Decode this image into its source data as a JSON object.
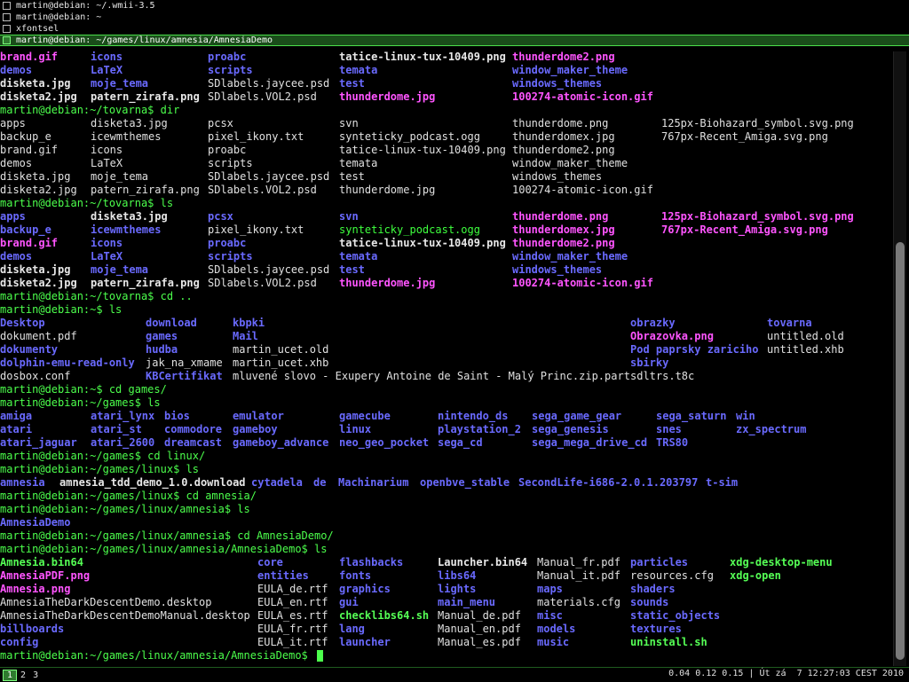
{
  "colors": {
    "prompt": "#4cff4c",
    "directory": "#6a6aff",
    "executable": "#55ff55",
    "image": "#ff55ff",
    "text": "#e0e0e0",
    "border_active": "#4be04b"
  },
  "windows": [
    {
      "title": "martin@debian: ~/.wmii-3.5"
    },
    {
      "title": "martin@debian: ~"
    },
    {
      "title": "xfontsel"
    },
    {
      "title": "martin@debian: ~/games/linux/amnesia/AmnesiaDemo",
      "active": true
    }
  ],
  "terminal": {
    "lines": [
      [
        [
          0,
          "brand.gif",
          "i"
        ],
        [
          102,
          "icons",
          "d"
        ],
        [
          234,
          "proabc",
          "d"
        ],
        [
          382,
          "tatice-linux-tux-10409.png",
          "w"
        ],
        [
          577,
          "thunderdome2.png",
          "i"
        ]
      ],
      [
        [
          0,
          "demos",
          "d"
        ],
        [
          102,
          "LaTeX",
          "d"
        ],
        [
          234,
          "scripts",
          "d"
        ],
        [
          382,
          "temata",
          "d"
        ],
        [
          577,
          "window_maker_theme",
          "d"
        ]
      ],
      [
        [
          0,
          "disketa.jpg",
          "w"
        ],
        [
          102,
          "moje_tema",
          "d"
        ],
        [
          234,
          "SDlabels.jaycee.psd",
          ""
        ],
        [
          382,
          "test",
          "d"
        ],
        [
          577,
          "windows_themes",
          "d"
        ]
      ],
      [
        [
          0,
          "disketa2.jpg",
          "w"
        ],
        [
          102,
          "patern_zirafa.png",
          "w"
        ],
        [
          234,
          "SDlabels.VOL2.psd",
          ""
        ],
        [
          382,
          "thunderdome.jpg",
          "i"
        ],
        [
          577,
          "100274-atomic-icon.gif",
          "i"
        ]
      ],
      [
        [
          0,
          "martin@debian:~/tovarna$ dir",
          "p"
        ]
      ],
      [
        [
          0,
          "apps",
          ""
        ],
        [
          102,
          "disketa3.jpg",
          ""
        ],
        [
          234,
          "pcsx",
          ""
        ],
        [
          382,
          "svn",
          ""
        ],
        [
          577,
          "thunderdome.png",
          ""
        ],
        [
          745,
          "125px-Biohazard_symbol.svg.png",
          ""
        ]
      ],
      [
        [
          0,
          "backup_e",
          ""
        ],
        [
          102,
          "icewmthemes",
          ""
        ],
        [
          234,
          "pixel_ikony.txt",
          ""
        ],
        [
          382,
          "synteticky_podcast.ogg",
          ""
        ],
        [
          577,
          "thunderdomex.jpg",
          ""
        ],
        [
          745,
          "767px-Recent_Amiga.svg.png",
          ""
        ]
      ],
      [
        [
          0,
          "brand.gif",
          ""
        ],
        [
          102,
          "icons",
          ""
        ],
        [
          234,
          "proabc",
          ""
        ],
        [
          382,
          "tatice-linux-tux-10409.png",
          ""
        ],
        [
          577,
          "thunderdome2.png",
          ""
        ]
      ],
      [
        [
          0,
          "demos",
          ""
        ],
        [
          102,
          "LaTeX",
          ""
        ],
        [
          234,
          "scripts",
          ""
        ],
        [
          382,
          "temata",
          ""
        ],
        [
          577,
          "window_maker_theme",
          ""
        ]
      ],
      [
        [
          0,
          "disketa.jpg",
          ""
        ],
        [
          102,
          "moje_tema",
          ""
        ],
        [
          234,
          "SDlabels.jaycee.psd",
          ""
        ],
        [
          382,
          "test",
          ""
        ],
        [
          577,
          "windows_themes",
          ""
        ]
      ],
      [
        [
          0,
          "disketa2.jpg",
          ""
        ],
        [
          102,
          "patern_zirafa.png",
          ""
        ],
        [
          234,
          "SDlabels.VOL2.psd",
          ""
        ],
        [
          382,
          "thunderdome.jpg",
          ""
        ],
        [
          577,
          "100274-atomic-icon.gif",
          ""
        ]
      ],
      [
        [
          0,
          "martin@debian:~/tovarna$ ls",
          "p"
        ]
      ],
      [
        [
          0,
          "apps",
          "d"
        ],
        [
          102,
          "disketa3.jpg",
          "w"
        ],
        [
          234,
          "pcsx",
          "d"
        ],
        [
          382,
          "svn",
          "d"
        ],
        [
          577,
          "thunderdome.png",
          "i"
        ],
        [
          745,
          "125px-Biohazard_symbol.svg.png",
          "i"
        ]
      ],
      [
        [
          0,
          "backup_e",
          "d"
        ],
        [
          102,
          "icewmthemes",
          "d"
        ],
        [
          234,
          "pixel_ikony.txt",
          ""
        ],
        [
          382,
          "synteticky_podcast.ogg",
          "t"
        ],
        [
          577,
          "thunderdomex.jpg",
          "i"
        ],
        [
          745,
          "767px-Recent_Amiga.svg.png",
          "i"
        ]
      ],
      [
        [
          0,
          "brand.gif",
          "i"
        ],
        [
          102,
          "icons",
          "d"
        ],
        [
          234,
          "proabc",
          "d"
        ],
        [
          382,
          "tatice-linux-tux-10409.png",
          "w"
        ],
        [
          577,
          "thunderdome2.png",
          "i"
        ]
      ],
      [
        [
          0,
          "demos",
          "d"
        ],
        [
          102,
          "LaTeX",
          "d"
        ],
        [
          234,
          "scripts",
          "d"
        ],
        [
          382,
          "temata",
          "d"
        ],
        [
          577,
          "window_maker_theme",
          "d"
        ]
      ],
      [
        [
          0,
          "disketa.jpg",
          "w"
        ],
        [
          102,
          "moje_tema",
          "d"
        ],
        [
          234,
          "SDlabels.jaycee.psd",
          ""
        ],
        [
          382,
          "test",
          "d"
        ],
        [
          577,
          "windows_themes",
          "d"
        ]
      ],
      [
        [
          0,
          "disketa2.jpg",
          "w"
        ],
        [
          102,
          "patern_zirafa.png",
          "w"
        ],
        [
          234,
          "SDlabels.VOL2.psd",
          ""
        ],
        [
          382,
          "thunderdome.jpg",
          "i"
        ],
        [
          577,
          "100274-atomic-icon.gif",
          "i"
        ]
      ],
      [
        [
          0,
          "martin@debian:~/tovarna$ cd ..",
          "p"
        ]
      ],
      [
        [
          0,
          "martin@debian:~$ ls",
          "p"
        ]
      ],
      [
        [
          0,
          "Desktop",
          "d"
        ],
        [
          164,
          "download",
          "d"
        ],
        [
          262,
          "kbpki",
          "d"
        ],
        [
          710,
          "obrazky",
          "d"
        ],
        [
          864,
          "tovarna",
          "d"
        ]
      ],
      [
        [
          0,
          "dokument.pdf",
          ""
        ],
        [
          164,
          "games",
          "d"
        ],
        [
          262,
          "Mail",
          "d"
        ],
        [
          710,
          "Obrazovka.png",
          "i"
        ],
        [
          864,
          "untitled.old",
          ""
        ]
      ],
      [
        [
          0,
          "dokumenty",
          "d"
        ],
        [
          164,
          "hudba",
          "d"
        ],
        [
          262,
          "martin_ucet.old",
          ""
        ],
        [
          710,
          "Pod paprsky zariciho",
          "d"
        ],
        [
          864,
          "untitled.xhb",
          ""
        ]
      ],
      [
        [
          0,
          "dolphin-emu-read-only",
          "d"
        ],
        [
          164,
          "jak_na_xmame",
          ""
        ],
        [
          262,
          "martin_ucet.xhb",
          ""
        ],
        [
          710,
          "sbirky",
          "d"
        ]
      ],
      [
        [
          0,
          "dosbox.conf",
          ""
        ],
        [
          164,
          "KBCertifikat",
          "d"
        ],
        [
          262,
          "mluvené slovo - Exupery Antoine de Saint - Malý Princ.zip.part",
          ""
        ],
        [
          710,
          "sdltrs.t8c",
          ""
        ]
      ],
      [
        [
          0,
          "martin@debian:~$ cd games/",
          "p"
        ]
      ],
      [
        [
          0,
          "martin@debian:~/games$ ls",
          "p"
        ]
      ],
      [
        [
          0,
          "amiga",
          "d"
        ],
        [
          102,
          "atari_lynx",
          "d"
        ],
        [
          185,
          "bios",
          "d"
        ],
        [
          262,
          "emulator",
          "d"
        ],
        [
          382,
          "gamecube",
          "d"
        ],
        [
          493,
          "nintendo_ds",
          "d"
        ],
        [
          599,
          "sega_game_gear",
          "d"
        ],
        [
          739,
          "sega_saturn",
          "d"
        ],
        [
          829,
          "win",
          "d"
        ]
      ],
      [
        [
          0,
          "atari",
          "d"
        ],
        [
          102,
          "atari_st",
          "d"
        ],
        [
          185,
          "commodore",
          "d"
        ],
        [
          262,
          "gameboy",
          "d"
        ],
        [
          382,
          "linux",
          "d"
        ],
        [
          493,
          "playstation_2",
          "d"
        ],
        [
          599,
          "sega_genesis",
          "d"
        ],
        [
          739,
          "snes",
          "d"
        ],
        [
          829,
          "zx_spectrum",
          "d"
        ]
      ],
      [
        [
          0,
          "atari_jaguar",
          "d"
        ],
        [
          102,
          "atari_2600",
          "d"
        ],
        [
          185,
          "dreamcast",
          "d"
        ],
        [
          262,
          "gameboy_advance",
          "d"
        ],
        [
          382,
          "neo_geo_pocket",
          "d"
        ],
        [
          493,
          "sega_cd",
          "d"
        ],
        [
          599,
          "sega_mega_drive_cd",
          "d"
        ],
        [
          739,
          "TRS80",
          "d"
        ]
      ],
      [
        [
          0,
          "martin@debian:~/games$ cd linux/",
          "p"
        ]
      ],
      [
        [
          0,
          "martin@debian:~/games/linux$ ls",
          "p"
        ]
      ],
      [
        [
          0,
          "amnesia",
          "d"
        ],
        [
          67,
          "amnesia_tdd_demo_1.0.download",
          "w"
        ],
        [
          283,
          "cytadela",
          "d"
        ],
        [
          353,
          "de",
          "d"
        ],
        [
          381,
          "Machinarium",
          "d"
        ],
        [
          473,
          "openbve_stable",
          "d"
        ],
        [
          584,
          "SecondLife-i686-2.0.1.203797",
          "d"
        ],
        [
          795,
          "t-sim",
          "d"
        ]
      ],
      [
        [
          0,
          "martin@debian:~/games/linux$ cd amnesia/",
          "p"
        ]
      ],
      [
        [
          0,
          "martin@debian:~/games/linux/amnesia$ ls",
          "p"
        ]
      ],
      [
        [
          0,
          "AmnesiaDemo",
          "d"
        ]
      ],
      [
        [
          0,
          "martin@debian:~/games/linux/amnesia$ cd AmnesiaDemo/",
          "p"
        ]
      ],
      [
        [
          0,
          "martin@debian:~/games/linux/amnesia/AmnesiaDemo$ ls",
          "p"
        ]
      ],
      [
        [
          0,
          "Amnesia.bin64",
          "x"
        ],
        [
          290,
          "core",
          "d"
        ],
        [
          382,
          "flashbacks",
          "d"
        ],
        [
          493,
          "Launcher.bin64",
          "w"
        ],
        [
          605,
          "Manual_fr.pdf",
          ""
        ],
        [
          710,
          "particles",
          "d"
        ],
        [
          822,
          "xdg-desktop-menu",
          "x"
        ]
      ],
      [
        [
          0,
          "AmnesiaPDF.png",
          "i"
        ],
        [
          290,
          "entities",
          "d"
        ],
        [
          382,
          "fonts",
          "d"
        ],
        [
          493,
          "libs64",
          "d"
        ],
        [
          605,
          "Manual_it.pdf",
          ""
        ],
        [
          710,
          "resources.cfg",
          ""
        ],
        [
          822,
          "xdg-open",
          "x"
        ]
      ],
      [
        [
          0,
          "Amnesia.png",
          "i"
        ],
        [
          290,
          "EULA_de.rtf",
          ""
        ],
        [
          382,
          "graphics",
          "d"
        ],
        [
          493,
          "lights",
          "d"
        ],
        [
          605,
          "maps",
          "d"
        ],
        [
          710,
          "shaders",
          "d"
        ]
      ],
      [
        [
          0,
          "AmnesiaTheDarkDescentDemo.desktop",
          ""
        ],
        [
          290,
          "EULA_en.rtf",
          ""
        ],
        [
          382,
          "gui",
          "d"
        ],
        [
          493,
          "main_menu",
          "d"
        ],
        [
          605,
          "materials.cfg",
          ""
        ],
        [
          710,
          "sounds",
          "d"
        ]
      ],
      [
        [
          0,
          "AmnesiaTheDarkDescentDemoManual.desktop",
          ""
        ],
        [
          290,
          "EULA_es.rtf",
          ""
        ],
        [
          382,
          "checklibs64.sh",
          "x"
        ],
        [
          493,
          "Manual_de.pdf",
          ""
        ],
        [
          605,
          "misc",
          "d"
        ],
        [
          710,
          "static_objects",
          "d"
        ]
      ],
      [
        [
          0,
          "billboards",
          "d"
        ],
        [
          290,
          "EULA_fr.rtf",
          ""
        ],
        [
          382,
          "lang",
          "d"
        ],
        [
          493,
          "Manual_en.pdf",
          ""
        ],
        [
          605,
          "models",
          "d"
        ],
        [
          710,
          "textures",
          "d"
        ]
      ],
      [
        [
          0,
          "config",
          "d"
        ],
        [
          290,
          "EULA_it.rtf",
          ""
        ],
        [
          382,
          "launcher",
          "d"
        ],
        [
          493,
          "Manual_es.pdf",
          ""
        ],
        [
          605,
          "music",
          "d"
        ],
        [
          710,
          "uninstall.sh",
          "x"
        ]
      ]
    ],
    "prompt": "martin@debian:~/games/linux/amnesia/AmnesiaDemo$ "
  },
  "status": {
    "tags": [
      "1",
      "2",
      "3"
    ],
    "active_tag": "1",
    "right_text": "0.04 0.12 0.15 | Út zá  7 12:27:03 CEST 2010"
  },
  "scrollbar": {
    "position": 0.31,
    "size": 0.68
  }
}
